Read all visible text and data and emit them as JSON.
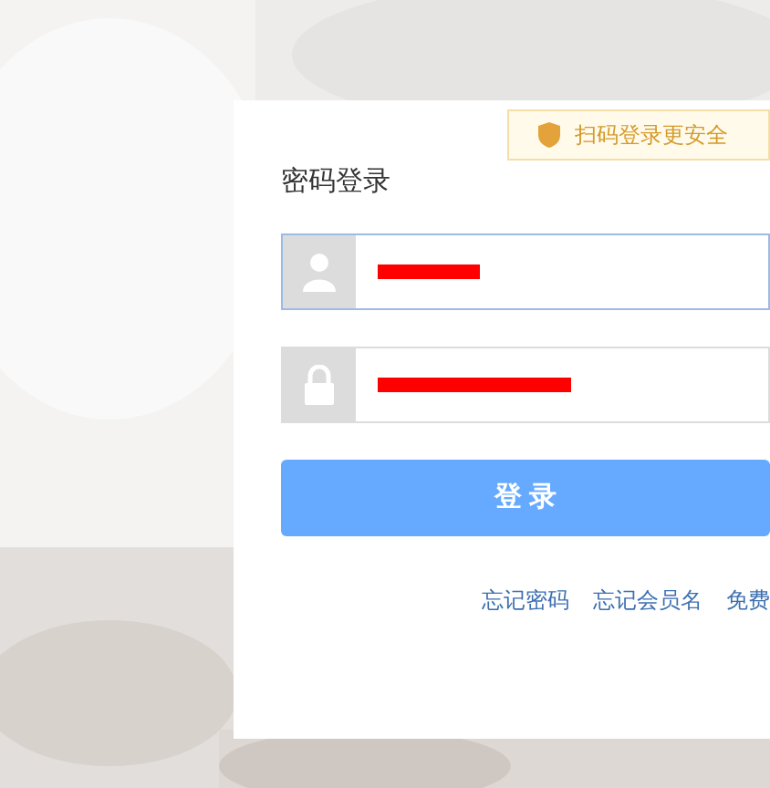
{
  "security_badge": {
    "label": "扫码登录更安全"
  },
  "title": "密码登录",
  "fields": [
    {
      "kind": "user",
      "focused": true,
      "redacted": true
    },
    {
      "kind": "password",
      "focused": false,
      "redacted": true
    }
  ],
  "login_button": {
    "label": "登 录"
  },
  "links": [
    "忘记密码",
    "忘记会员名",
    "免费"
  ]
}
